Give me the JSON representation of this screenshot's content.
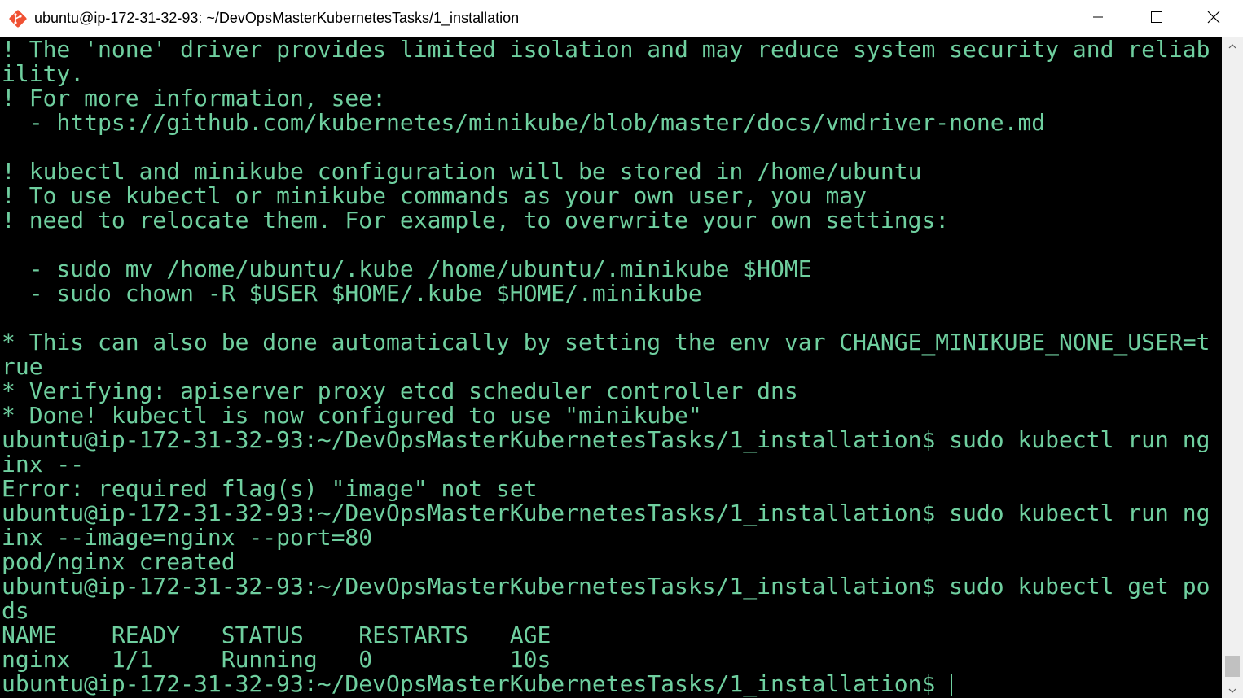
{
  "window": {
    "title": "ubuntu@ip-172-31-32-93: ~/DevOpsMasterKubernetesTasks/1_installation",
    "icon": "git-bash-icon",
    "controls": [
      "minimize-icon",
      "maximize-icon",
      "close-icon"
    ]
  },
  "colors": {
    "terminal_bg": "#000000",
    "terminal_fg": "#6fcf9f",
    "titlebar_bg": "#ffffff",
    "scrollbar_bg": "#f0f0f0"
  },
  "terminal": {
    "lines": [
      "! The 'none' driver provides limited isolation and may reduce system security and reliab",
      "ility.",
      "! For more information, see:",
      "  - https://github.com/kubernetes/minikube/blob/master/docs/vmdriver-none.md",
      "",
      "! kubectl and minikube configuration will be stored in /home/ubuntu",
      "! To use kubectl or minikube commands as your own user, you may",
      "! need to relocate them. For example, to overwrite your own settings:",
      "",
      "  - sudo mv /home/ubuntu/.kube /home/ubuntu/.minikube $HOME",
      "  - sudo chown -R $USER $HOME/.kube $HOME/.minikube",
      "",
      "* This can also be done automatically by setting the env var CHANGE_MINIKUBE_NONE_USER=t",
      "rue",
      "* Verifying: apiserver proxy etcd scheduler controller dns",
      "* Done! kubectl is now configured to use \"minikube\"",
      "ubuntu@ip-172-31-32-93:~/DevOpsMasterKubernetesTasks/1_installation$ sudo kubectl run ng",
      "inx --",
      "Error: required flag(s) \"image\" not set",
      "ubuntu@ip-172-31-32-93:~/DevOpsMasterKubernetesTasks/1_installation$ sudo kubectl run ng",
      "inx --image=nginx --port=80",
      "pod/nginx created",
      "ubuntu@ip-172-31-32-93:~/DevOpsMasterKubernetesTasks/1_installation$ sudo kubectl get po",
      "ds",
      "NAME    READY   STATUS    RESTARTS   AGE",
      "nginx   1/1     Running   0          10s"
    ],
    "prompt": "ubuntu@ip-172-31-32-93:~/DevOpsMasterKubernetesTasks/1_installation$ "
  }
}
